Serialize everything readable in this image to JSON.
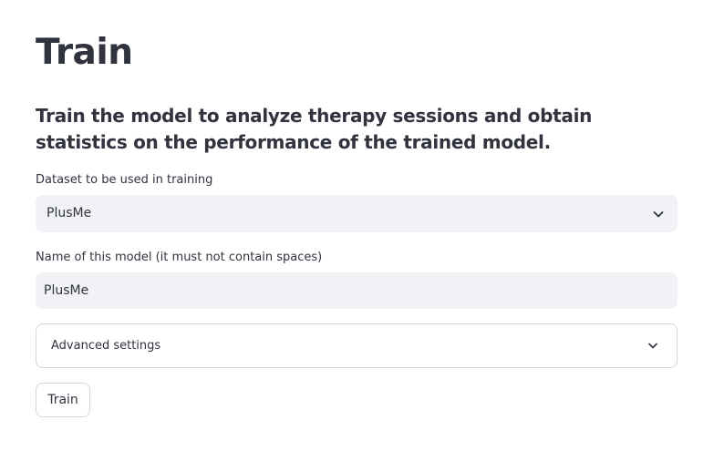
{
  "page": {
    "title": "Train",
    "subtitle": "Train the model to analyze therapy sessions and obtain statistics on the performance of the trained model."
  },
  "dataset": {
    "label": "Dataset to be used in training",
    "selected": "PlusMe",
    "icon": "chevron-down-icon"
  },
  "model_name": {
    "label": "Name of this model (it must not contain spaces)",
    "value": "PlusMe"
  },
  "advanced": {
    "label": "Advanced settings",
    "expanded": false,
    "icon": "chevron-down-icon"
  },
  "actions": {
    "train_label": "Train"
  },
  "colors": {
    "text": "#31333f",
    "input_background": "#f0f2f6",
    "border": "#d6d6d9",
    "background": "#ffffff"
  }
}
